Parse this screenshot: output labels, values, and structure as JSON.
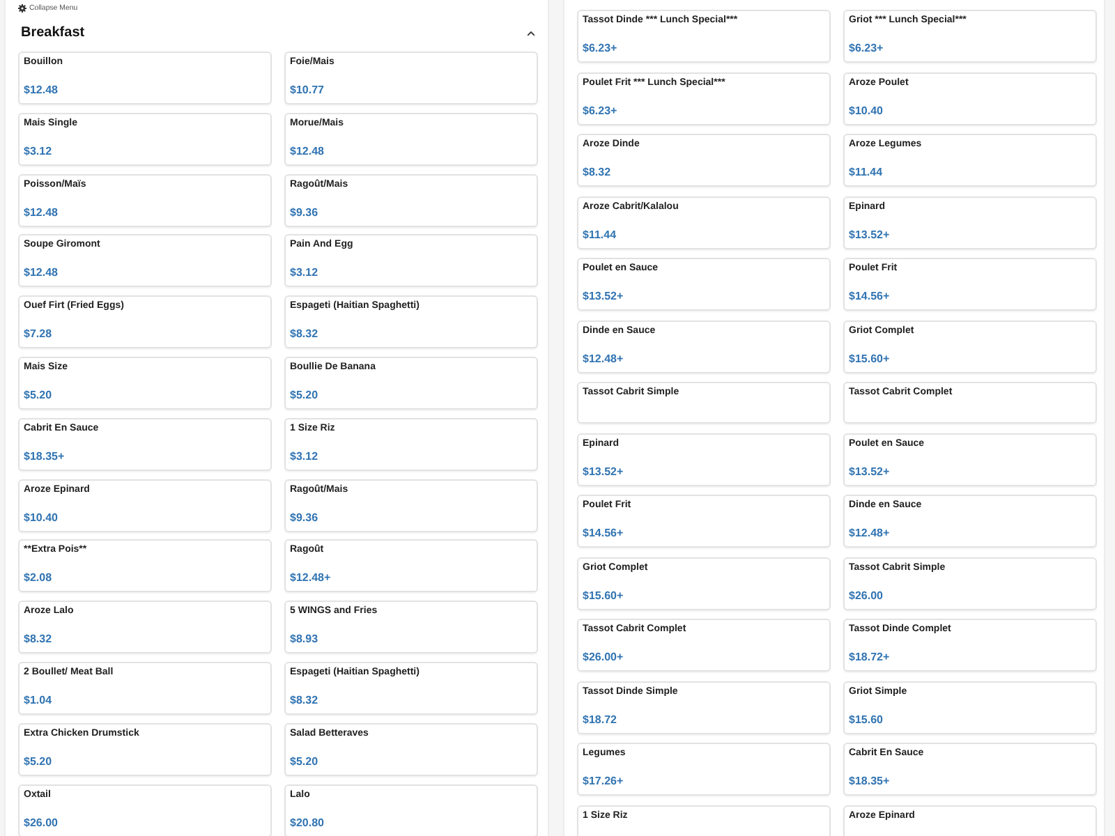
{
  "header": {
    "collapse_label": "Collapse Menu"
  },
  "left_section": {
    "title": "Breakfast",
    "expanded": true,
    "items": [
      {
        "name": "Bouillon",
        "price": "$12.48"
      },
      {
        "name": "Foie/Mais",
        "price": "$10.77"
      },
      {
        "name": "Mais Single",
        "price": "$3.12"
      },
      {
        "name": "Morue/Mais",
        "price": "$12.48"
      },
      {
        "name": "Poisson/Maïs",
        "price": "$12.48"
      },
      {
        "name": "Ragoût/Mais",
        "price": "$9.36"
      },
      {
        "name": "Soupe Giromont",
        "price": "$12.48"
      },
      {
        "name": "Pain And Egg",
        "price": "$3.12"
      },
      {
        "name": "Ouef Firt (Fried Eggs)",
        "price": "$7.28"
      },
      {
        "name": "Espageti (Haitian Spaghetti)",
        "price": "$8.32"
      },
      {
        "name": "Mais Size",
        "price": "$5.20"
      },
      {
        "name": "Boullie De Banana",
        "price": "$5.20"
      },
      {
        "name": "Cabrit En Sauce",
        "price": "$18.35+"
      },
      {
        "name": "1 Size Riz",
        "price": "$3.12"
      },
      {
        "name": "Aroze Epinard",
        "price": "$10.40"
      },
      {
        "name": "Ragoût/Mais",
        "price": "$9.36"
      },
      {
        "name": "**Extra Pois**",
        "price": "$2.08"
      },
      {
        "name": "Ragoût",
        "price": "$12.48+"
      },
      {
        "name": "Aroze Lalo",
        "price": "$8.32"
      },
      {
        "name": "5 WINGS and Fries",
        "price": "$8.93"
      },
      {
        "name": "2 Boullet/ Meat Ball",
        "price": "$1.04"
      },
      {
        "name": "Espageti (Haitian Spaghetti)",
        "price": "$8.32"
      },
      {
        "name": "Extra Chicken Drumstick",
        "price": "$5.20"
      },
      {
        "name": "Salad Betteraves",
        "price": "$5.20"
      },
      {
        "name": "Oxtail",
        "price": "$26.00"
      },
      {
        "name": "Lalo",
        "price": "$20.80"
      }
    ]
  },
  "right_section": {
    "items": [
      {
        "name": "Tassot Dinde *** Lunch Special***",
        "price": "$6.23+"
      },
      {
        "name": "Griot *** Lunch Special***",
        "price": "$6.23+"
      },
      {
        "name": "Poulet Frit *** Lunch Special***",
        "price": "$6.23+"
      },
      {
        "name": "Aroze Poulet",
        "price": "$10.40"
      },
      {
        "name": "Aroze Dinde",
        "price": "$8.32"
      },
      {
        "name": "Aroze Legumes",
        "price": "$11.44"
      },
      {
        "name": "Aroze Cabrit/Kalalou",
        "price": "$11.44"
      },
      {
        "name": "Epinard",
        "price": "$13.52+"
      },
      {
        "name": "Poulet en Sauce",
        "price": "$13.52+"
      },
      {
        "name": "Poulet Frit",
        "price": "$14.56+"
      },
      {
        "name": "Dinde en Sauce",
        "price": "$12.48+"
      },
      {
        "name": "Griot Complet",
        "price": "$15.60+"
      },
      {
        "name": "Tassot Cabrit Simple"
      },
      {
        "name": "Tassot Cabrit Complet"
      },
      {
        "name": "Epinard",
        "price": "$13.52+"
      },
      {
        "name": "Poulet en Sauce",
        "price": "$13.52+"
      },
      {
        "name": "Poulet Frit",
        "price": "$14.56+"
      },
      {
        "name": "Dinde en Sauce",
        "price": "$12.48+"
      },
      {
        "name": "Griot Complet",
        "price": "$15.60+"
      },
      {
        "name": "Tassot Cabrit Simple",
        "price": "$26.00"
      },
      {
        "name": "Tassot Cabrit Complet",
        "price": "$26.00+"
      },
      {
        "name": "Tassot Dinde Complet",
        "price": "$18.72+"
      },
      {
        "name": "Tassot Dinde Simple",
        "price": "$18.72"
      },
      {
        "name": "Griot Simple",
        "price": "$15.60"
      },
      {
        "name": "Legumes",
        "price": "$17.26+"
      },
      {
        "name": "Cabrit En Sauce",
        "price": "$18.35+"
      },
      {
        "name": "1 Size Riz"
      },
      {
        "name": "Aroze Epinard"
      }
    ]
  }
}
